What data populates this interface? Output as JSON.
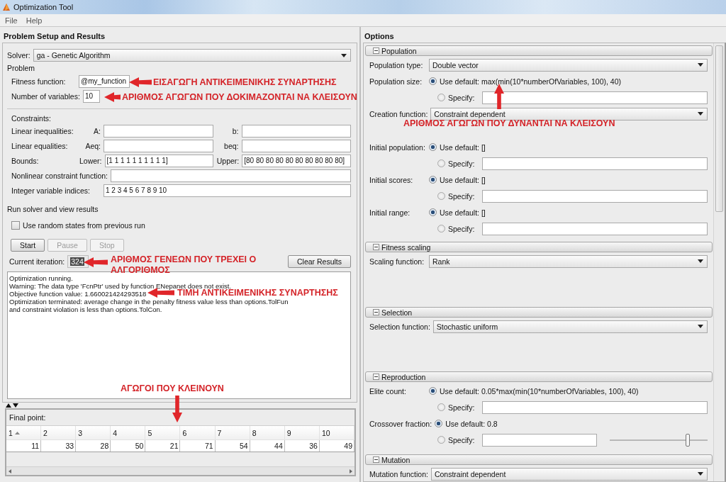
{
  "window": {
    "title": "Optimization Tool"
  },
  "menu": [
    {
      "label": "File"
    },
    {
      "label": "Help"
    }
  ],
  "problem_panel": {
    "title": "Problem Setup and Results",
    "solver": {
      "label": "Solver:",
      "value": "ga - Genetic Algorithm"
    },
    "problem_heading": "Problem",
    "problem_fields": [
      {
        "label": "Fitness function:",
        "value": "@my_function"
      },
      {
        "label": "Number of variables:",
        "value": "10"
      }
    ],
    "constraints_heading": "Constraints:",
    "constraints": [
      {
        "kind": "pair",
        "label": "Linear inequalities:",
        "fields": [
          {
            "label": "A:"
          },
          {
            "label": "b:"
          }
        ]
      },
      {
        "kind": "pair",
        "label": "Linear equalities:",
        "fields": [
          {
            "label": "Aeq:"
          },
          {
            "label": "beq:"
          }
        ]
      },
      {
        "kind": "pair",
        "label": "Bounds:",
        "fields": [
          {
            "label": "Lower:",
            "value": "[1 1 1 1 1 1 1 1 1 1]"
          },
          {
            "label": "Upper:",
            "value": "[80 80 80 80 80 80 80 80 80 80]"
          }
        ]
      },
      {
        "kind": "single",
        "label": "Nonlinear constraint function:"
      },
      {
        "kind": "single",
        "label": "Integer variable indices:",
        "value": "1 2 3 4 5 6 7 8 9 10"
      }
    ],
    "run_heading": "Run solver and view results",
    "random_states": {
      "label": "Use random states from previous run",
      "checked": false
    },
    "buttons": [
      {
        "label": "Start",
        "disabled": false
      },
      {
        "label": "Pause",
        "disabled": true
      },
      {
        "label": "Stop",
        "disabled": true
      }
    ],
    "iteration": {
      "label": "Current iteration:",
      "value": "324",
      "highlighted": true
    },
    "clear_button": "Clear Results",
    "log": [
      "Optimization running.",
      "Warning: The data type 'FcnPtr' used by function ENepanet does not exist.",
      "Objective function value: 1.660021424293518",
      "Optimization terminated: average change in the penalty fitness value less than options.TolFun",
      "and constraint violation is less than options.TolCon."
    ],
    "final_point": {
      "label": "Final point:",
      "columns": [
        {
          "label": "1",
          "sorted": true
        },
        {
          "label": "2",
          "sorted": false
        },
        {
          "label": "3",
          "sorted": false
        },
        {
          "label": "4",
          "sorted": false
        },
        {
          "label": "5",
          "sorted": false
        },
        {
          "label": "6",
          "sorted": false
        },
        {
          "label": "7",
          "sorted": false
        },
        {
          "label": "8",
          "sorted": false
        },
        {
          "label": "9",
          "sorted": false
        },
        {
          "label": "10",
          "sorted": false
        }
      ],
      "values": [
        "11",
        "33",
        "28",
        "50",
        "21",
        "71",
        "54",
        "44",
        "36",
        "49"
      ]
    }
  },
  "options_panel": {
    "title": "Options",
    "sections": [
      {
        "title": "Population",
        "expanded": true,
        "rows": [
          {
            "kind": "dropdown",
            "label": "Population type:",
            "value": "Double vector"
          },
          {
            "kind": "radio",
            "label": "Population size:",
            "option": "Use default: max(min(10*numberOfVariables, 100), 40)",
            "selected": true
          },
          {
            "kind": "specify",
            "option": "Specify:",
            "selected": false
          },
          {
            "kind": "dropdown",
            "label": "Creation function:",
            "value": "Constraint dependent"
          },
          {
            "kind": "radio",
            "label": "Initial population:",
            "option": "Use default: []",
            "selected": true
          },
          {
            "kind": "specify",
            "option": "Specify:",
            "selected": false
          },
          {
            "kind": "radio",
            "label": "Initial scores:",
            "option": "Use default: []",
            "selected": true
          },
          {
            "kind": "specify",
            "option": "Specify:",
            "selected": false
          },
          {
            "kind": "radio",
            "label": "Initial range:",
            "option": "Use default: []",
            "selected": true
          },
          {
            "kind": "specify",
            "option": "Specify:",
            "selected": false
          }
        ]
      },
      {
        "title": "Fitness scaling",
        "expanded": true,
        "rows": [
          {
            "kind": "dropdown",
            "label": "Scaling function:",
            "value": "Rank"
          }
        ]
      },
      {
        "title": "Selection",
        "expanded": true,
        "rows": [
          {
            "kind": "dropdown",
            "label": "Selection function:",
            "value": "Stochastic uniform"
          }
        ]
      },
      {
        "title": "Reproduction",
        "expanded": true,
        "rows": [
          {
            "kind": "radio",
            "label": "Elite count:",
            "option": "Use default: 0.05*max(min(10*numberOfVariables, 100), 40)",
            "selected": true
          },
          {
            "kind": "specify",
            "option": "Specify:",
            "selected": false
          },
          {
            "kind": "radio",
            "label": "Crossover fraction:",
            "option": "Use default: 0.8",
            "selected": true
          },
          {
            "kind": "slider",
            "option": "Specify:",
            "selected": false,
            "level": 0.8
          }
        ]
      },
      {
        "title": "Mutation",
        "expanded": true,
        "rows": [
          {
            "kind": "dropdown",
            "label": "Mutation function:",
            "value": "Constraint dependent"
          }
        ]
      }
    ]
  },
  "annotations": [
    {
      "kind": "fitness",
      "text": "ΕΙΣΑΓΩΓΗ ΑΝΤΙΚΕΙΜΕΝΙΚΗΣ ΣΥΝΑΡΤΗΣΗΣ"
    },
    {
      "kind": "variables",
      "text": "ΑΡΙΘΜΟΣ ΑΓΩΓΩΝ ΠΟΥ ΔΟΚΙΜΑΖΟΝΤΑΙ ΝΑ ΚΛΕΙΣΟΥΝ"
    },
    {
      "kind": "population",
      "text": "ΑΡΙΘΜΟΣ ΑΓΩΓΩΝ ΠΟΥ ΔΥΝΑΝΤΑΙ ΝΑ ΚΛΕΙΣΟΥΝ"
    },
    {
      "kind": "iteration",
      "text": "ΑΡΙΘΜΟΣ ΓΕΝΕΩΝ ΠΟΥ ΤΡΕΧΕΙ Ο ΑΛΓΟΡΙΘΜΟΣ"
    },
    {
      "kind": "objective",
      "text": "ΤΙΜΗ ΑΝΤΙΚΕΙΜΕΝΙΚΗΣ ΣΥΝΑΡΤΗΣΗΣ"
    },
    {
      "kind": "final",
      "text": "ΑΓΩΓΟΙ ΠΟΥ ΚΛΕΙΝΟΥΝ"
    }
  ]
}
